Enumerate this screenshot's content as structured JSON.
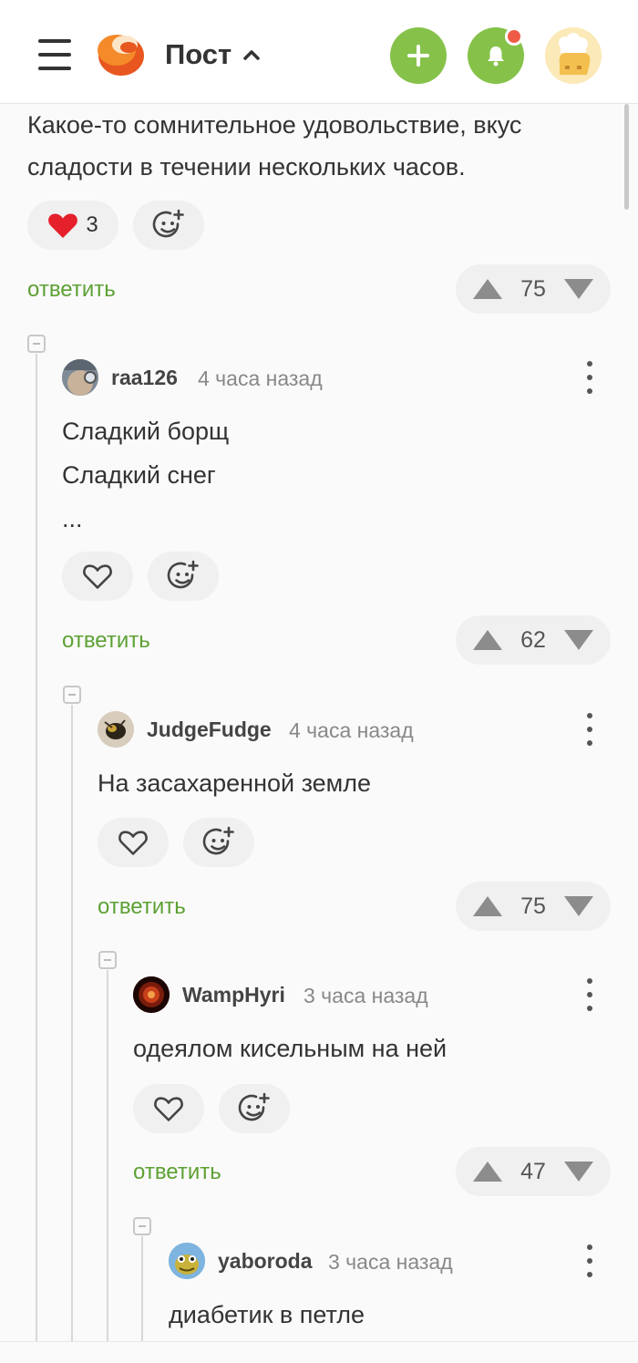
{
  "header": {
    "title": "Пост",
    "menu_icon": "hamburger-menu-icon",
    "logo_icon": "pikabu-logo",
    "add_icon": "plus-icon",
    "bell_icon": "bell-icon",
    "accent_color": "#86c24a",
    "notification_color": "#ef5b46"
  },
  "post": {
    "text_line1": "Какое-то сомнительное удовольствие, вкус",
    "text_line2": "сладости в течении нескольких часов.",
    "likes": "3",
    "reply_label": "ответить",
    "rating": "75"
  },
  "comments": [
    {
      "username": "raa126",
      "time": "4 часа назад",
      "lines": [
        "Сладкий борщ",
        "Сладкий снег",
        "..."
      ],
      "reply_label": "ответить",
      "rating": "62"
    },
    {
      "username": "JudgeFudge",
      "time": "4 часа назад",
      "lines": [
        "На засахаренной земле"
      ],
      "reply_label": "ответить",
      "rating": "75"
    },
    {
      "username": "WampHyri",
      "time": "3 часа назад",
      "lines": [
        "одеялом кисельным на ней"
      ],
      "reply_label": "ответить",
      "rating": "47"
    },
    {
      "username": "yaboroda",
      "time": "3 часа назад",
      "lines": [
        "диабетик в петле"
      ]
    }
  ]
}
